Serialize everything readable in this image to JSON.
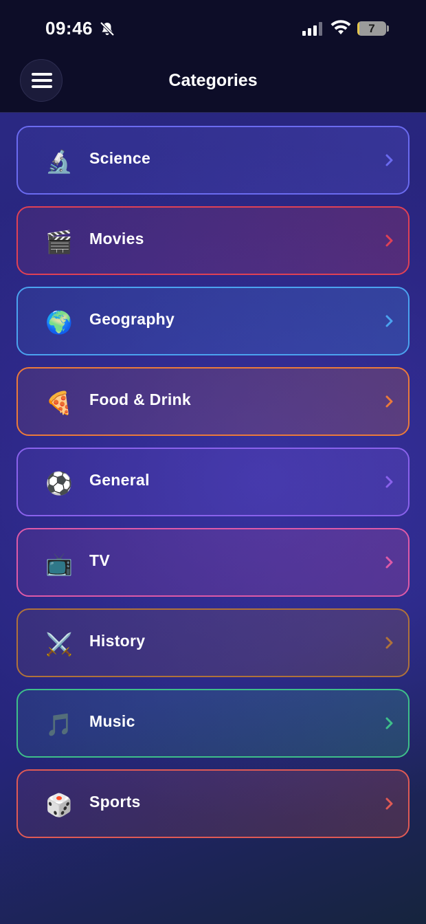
{
  "status_bar": {
    "time": "09:46",
    "battery_level": "7",
    "icons": [
      "bell-slash-icon",
      "cellular-signal-icon",
      "wifi-icon",
      "battery-icon"
    ]
  },
  "nav": {
    "title": "Categories",
    "menu_icon": "hamburger-menu-icon"
  },
  "categories": [
    {
      "label": "Science",
      "icon": "🔬",
      "icon_name": "microscope-icon",
      "accent": "#6b6bf0"
    },
    {
      "label": "Movies",
      "icon": "🎬",
      "icon_name": "clapper-board-icon",
      "accent": "#e04155"
    },
    {
      "label": "Geography",
      "icon": "🌍",
      "icon_name": "globe-icon",
      "accent": "#4ba3f0"
    },
    {
      "label": "Food & Drink",
      "icon": "🍕",
      "icon_name": "pizza-icon",
      "accent": "#ec7a3a"
    },
    {
      "label": "General",
      "icon": "⚽",
      "icon_name": "soccer-ball-icon",
      "accent": "#8a62ec"
    },
    {
      "label": "TV",
      "icon": "📺",
      "icon_name": "television-icon",
      "accent": "#de5aa8"
    },
    {
      "label": "History",
      "icon": "⚔️",
      "icon_name": "crossed-swords-icon",
      "accent": "#b0723a"
    },
    {
      "label": "Music",
      "icon": "🎵",
      "icon_name": "music-note-icon",
      "accent": "#3ec08a"
    },
    {
      "label": "Sports",
      "icon": "🎲",
      "icon_name": "dice-icon",
      "accent": "#e05a55"
    }
  ]
}
